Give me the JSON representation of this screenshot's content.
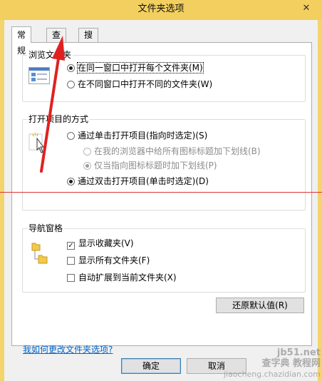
{
  "window": {
    "title": "文件夹选项",
    "close_label": "✕"
  },
  "tabs": [
    {
      "label": "常规"
    },
    {
      "label": "查看"
    },
    {
      "label": "搜索"
    }
  ],
  "browse_folders": {
    "title": "浏览文件夹",
    "options": [
      {
        "label": "在同一窗口中打开每个文件夹(M)",
        "checked": true
      },
      {
        "label": "在不同窗口中打开不同的文件夹(W)",
        "checked": false
      }
    ]
  },
  "open_items": {
    "title": "打开项目的方式",
    "single_click": {
      "label": "通过单击打开项目(指向时选定)(S)",
      "checked": false
    },
    "underline_browser": {
      "label": "在我的浏览器中给所有图标标题加下划线(B)",
      "checked": false
    },
    "underline_pointing": {
      "label": "仅当指向图标标题时加下划线(P)",
      "checked": true
    },
    "double_click": {
      "label": "通过双击打开项目(单击时选定)(D)",
      "checked": true
    }
  },
  "nav_pane": {
    "title": "导航窗格",
    "options": [
      {
        "label": "显示收藏夹(V)",
        "checked": true
      },
      {
        "label": "显示所有文件夹(F)",
        "checked": false
      },
      {
        "label": "自动扩展到当前文件夹(X)",
        "checked": false
      }
    ]
  },
  "restore_defaults_label": "还原默认值(R)",
  "help_link": "我如何更改文件夹选项?",
  "buttons": {
    "ok": "确定",
    "cancel": "取消"
  },
  "watermark": {
    "line1": "jb51.net",
    "line2": "查字典 教程网",
    "line3": "jiaocheng.chazidian.com"
  },
  "colors": {
    "titlebar": "#f2cf5e",
    "annotation_red": "#e02020",
    "link": "#0066cc"
  }
}
